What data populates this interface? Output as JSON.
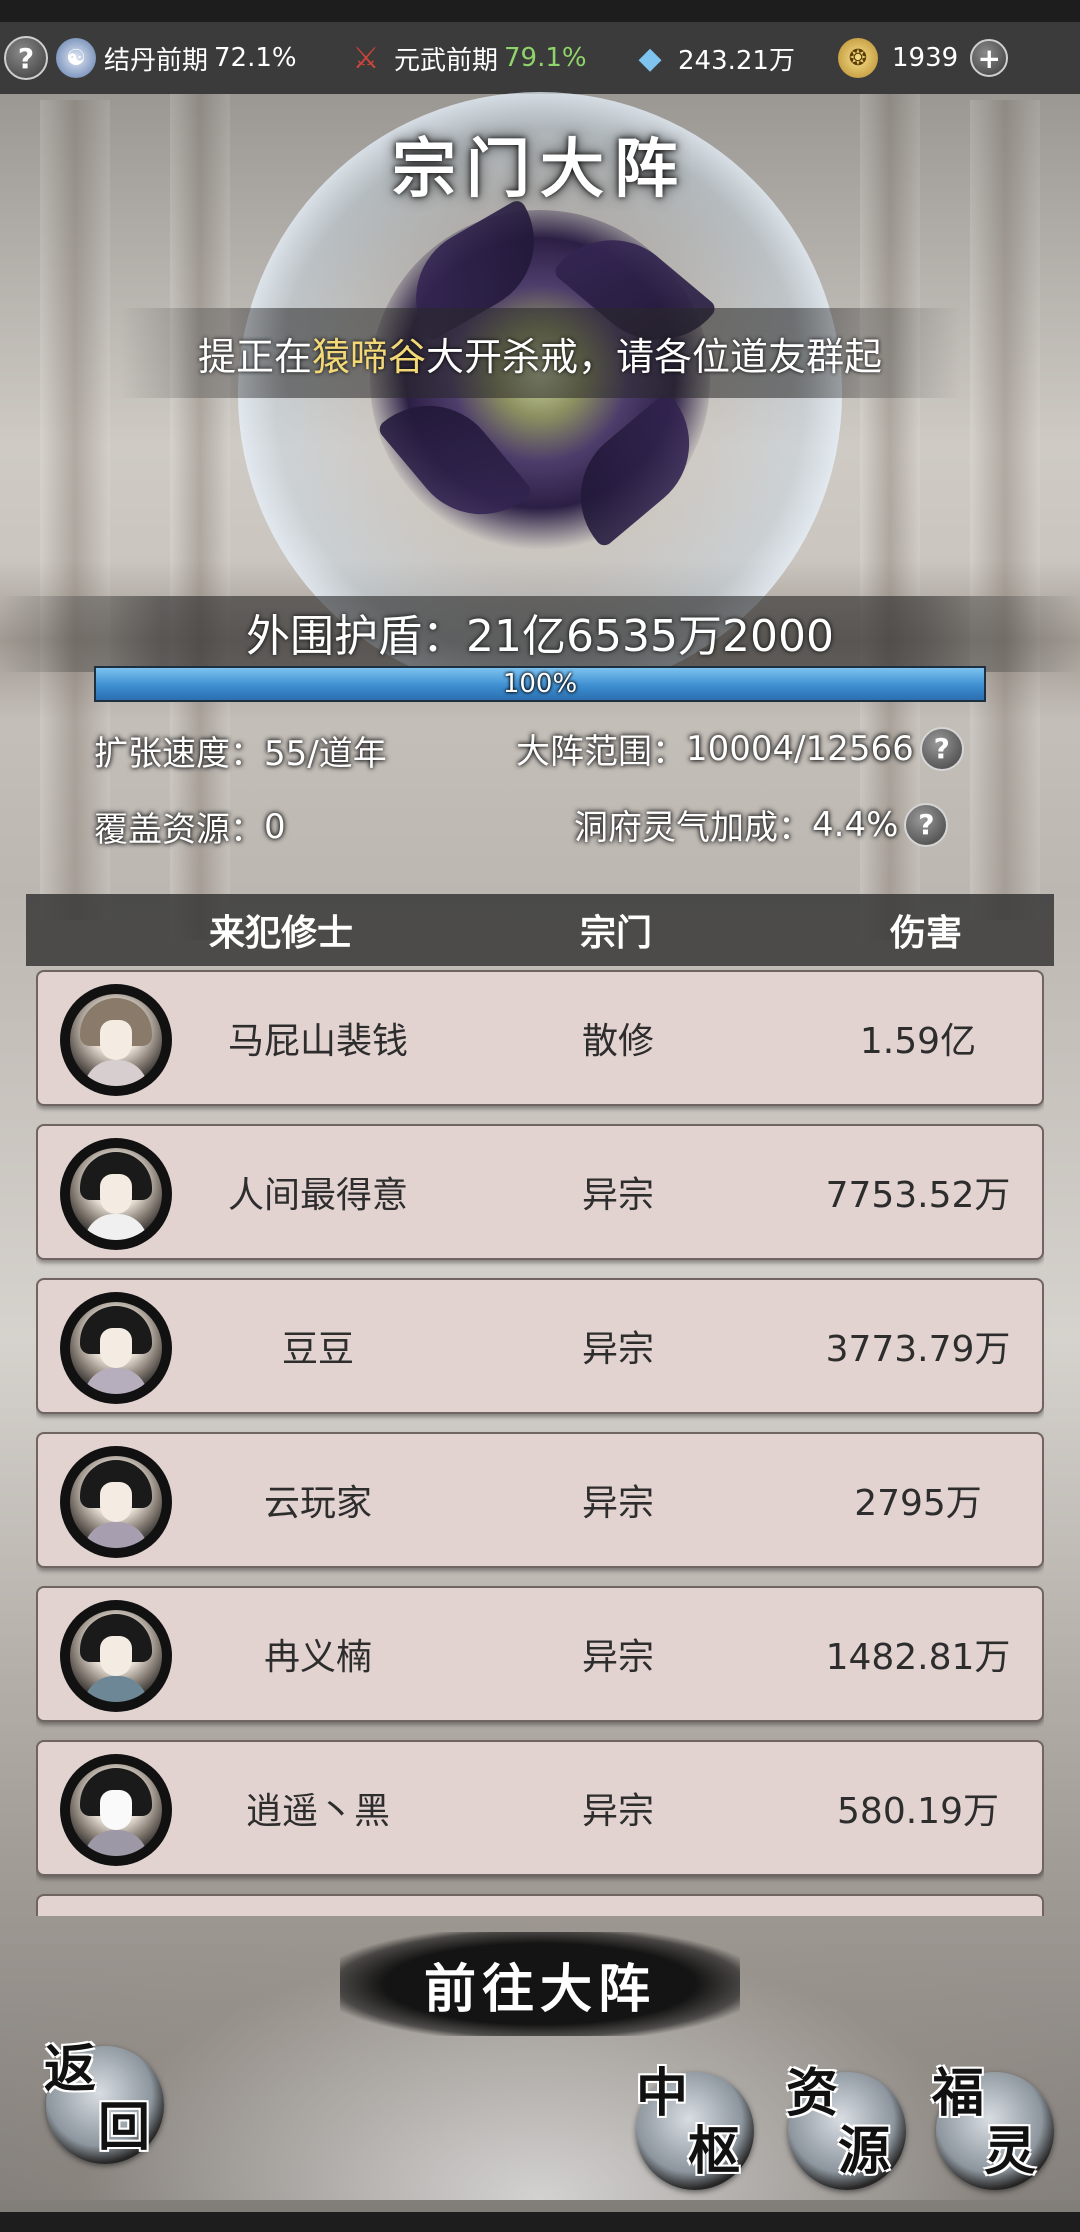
{
  "topbar": {
    "help_glyph": "?",
    "realm1": {
      "label": "结丹前期",
      "percent": "72.1%"
    },
    "realm2": {
      "label": "元武前期",
      "percent": "79.1%"
    },
    "spirit_stones": "243.21万",
    "currency": "1939",
    "add_glyph": "+"
  },
  "title": "宗门大阵",
  "broadcast": {
    "part1": "提正在",
    "place": "猿啼谷",
    "part2": "大开杀戒，请各位道友群起"
  },
  "shield": {
    "label": "外围护盾：",
    "value": "21亿6535万2000",
    "percent": "100%",
    "fill": 1.0
  },
  "stats": {
    "speed_label": "扩张速度：",
    "speed_value": "55/道年",
    "range_label": "大阵范围：",
    "range_value": "10004/12566",
    "resource_label": "覆盖资源：",
    "resource_value": "0",
    "bonus_label": "洞府灵气加成：",
    "bonus_value": "4.4%",
    "help_glyph": "?"
  },
  "table": {
    "headers": [
      "来犯修士",
      "宗门",
      "伤害"
    ],
    "rows": [
      {
        "name": "马屁山裴钱",
        "sect": "散修",
        "damage": "1.59亿"
      },
      {
        "name": "人间最得意",
        "sect": "异宗",
        "damage": "7753.52万"
      },
      {
        "name": "豆豆",
        "sect": "异宗",
        "damage": "3773.79万"
      },
      {
        "name": "云玩家",
        "sect": "异宗",
        "damage": "2795万"
      },
      {
        "name": "冉义楠",
        "sect": "异宗",
        "damage": "1482.81万"
      },
      {
        "name": "逍遥丶黑",
        "sect": "异宗",
        "damage": "580.19万"
      }
    ]
  },
  "buttons": {
    "go": "前往大阵",
    "back": {
      "top": "返",
      "bottom": "回"
    },
    "hub": {
      "top": "中",
      "bottom": "枢"
    },
    "resource": {
      "top": "资",
      "bottom": "源"
    },
    "fortune": {
      "top": "福",
      "bottom": "灵"
    }
  },
  "colors": {
    "highlight": "#f3d878",
    "progress": "#3d8ed0",
    "row_bg": "#e2d3d1",
    "realm_green": "#8fd46a"
  }
}
